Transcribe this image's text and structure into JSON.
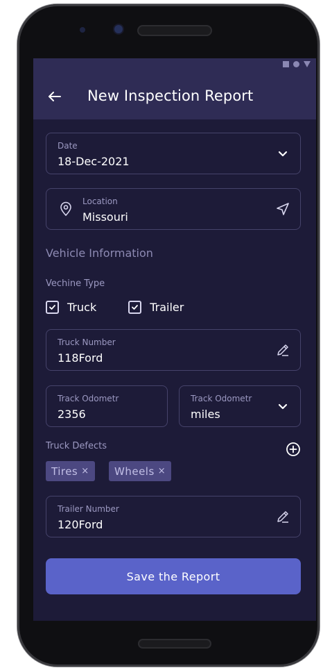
{
  "appbar": {
    "title": "New Inspection Report",
    "back_icon": "arrow-left-icon"
  },
  "date_field": {
    "label": "Date",
    "value": "18-Dec-2021",
    "icon": "chevron-down-icon"
  },
  "location_field": {
    "label": "Location",
    "value": "Missouri",
    "icon": "location-pin-icon",
    "action_icon": "send-icon"
  },
  "vehicle_section": {
    "title": "Vehicle Information"
  },
  "vehicle_type": {
    "label": "Vechine Type",
    "options": [
      {
        "label": "Truck",
        "checked": true
      },
      {
        "label": "Trailer",
        "checked": true
      }
    ]
  },
  "truck_number_field": {
    "label": "Truck Number",
    "value": "118Ford",
    "icon": "pencil-icon"
  },
  "odometer_field": {
    "label": "Track Odometr",
    "value": "2356"
  },
  "odometer_unit_field": {
    "label": "Track Odometr",
    "value": "miles",
    "icon": "chevron-down-icon"
  },
  "truck_defects": {
    "label": "Truck Defects",
    "add_icon": "plus-circle-icon",
    "chips": [
      {
        "label": "Tires",
        "remove": "×"
      },
      {
        "label": "Wheels",
        "remove": "×"
      }
    ]
  },
  "trailer_number_field": {
    "label": "Trailer Number",
    "value": "120Ford",
    "icon": "pencil-icon"
  },
  "save_button": {
    "label": "Save the Report"
  },
  "colors": {
    "background": "#1d1b38",
    "appbar": "#2f2c55",
    "accent": "#5a63c9",
    "chip": "#4c4881"
  }
}
